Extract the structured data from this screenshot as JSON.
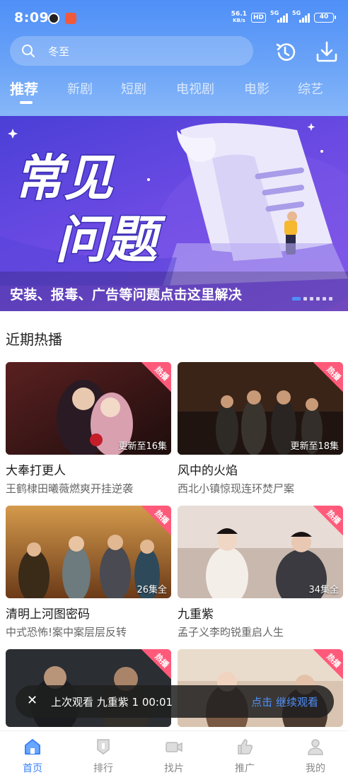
{
  "status_bar": {
    "time": "8:09",
    "net_speed_value": "56.1",
    "net_speed_unit": "KB/s",
    "hd_badge": "HD",
    "sim1": "5G",
    "sim2": "5G",
    "battery": "40"
  },
  "search": {
    "value": "冬至"
  },
  "tabs": [
    {
      "label": "推荐",
      "active": true
    },
    {
      "label": "新剧",
      "active": false
    },
    {
      "label": "短剧",
      "active": false
    },
    {
      "label": "电视剧",
      "active": false
    },
    {
      "label": "电影",
      "active": false
    },
    {
      "label": "综艺",
      "active": false
    }
  ],
  "banner": {
    "headline_line1": "常见",
    "headline_line2": "问题",
    "caption": "安装、报毒、广告等问题点击这里解决",
    "page_count": 6,
    "current_page": 1
  },
  "section": {
    "title": "近期热播"
  },
  "cards": [
    {
      "title": "大奉打更人",
      "subtitle": "王鹤棣田曦薇燃爽开挂逆袭",
      "episodes": "更新至16集",
      "badge": "热播"
    },
    {
      "title": "风中的火焰",
      "subtitle": "西北小镇惊现连环焚尸案",
      "episodes": "更新至18集",
      "badge": "热播"
    },
    {
      "title": "清明上河图密码",
      "subtitle": "中式恐怖!案中案层层反转",
      "episodes": "26集全",
      "badge": "热播"
    },
    {
      "title": "九重紫",
      "subtitle": "孟子义李昀锐重启人生",
      "episodes": "34集全",
      "badge": "热播"
    },
    {
      "title": "",
      "subtitle": "",
      "episodes": "",
      "badge": "热播"
    },
    {
      "title": "",
      "subtitle": "",
      "episodes": "",
      "badge": "热播"
    }
  ],
  "continue_watching": {
    "message": "上次观看 九重紫 1  00:01",
    "action": "点击 继续观看"
  },
  "bottom_nav": [
    {
      "label": "首页",
      "icon": "home-icon",
      "active": true
    },
    {
      "label": "排行",
      "icon": "ranking-icon",
      "active": false
    },
    {
      "label": "找片",
      "icon": "video-camera-icon",
      "active": false
    },
    {
      "label": "推广",
      "icon": "thumbs-up-icon",
      "active": false
    },
    {
      "label": "我的",
      "icon": "user-icon",
      "active": false
    }
  ],
  "colors": {
    "accent": "#4f8ff7",
    "badge": "#ff5a7a",
    "nav_active": "#3b82f6"
  }
}
